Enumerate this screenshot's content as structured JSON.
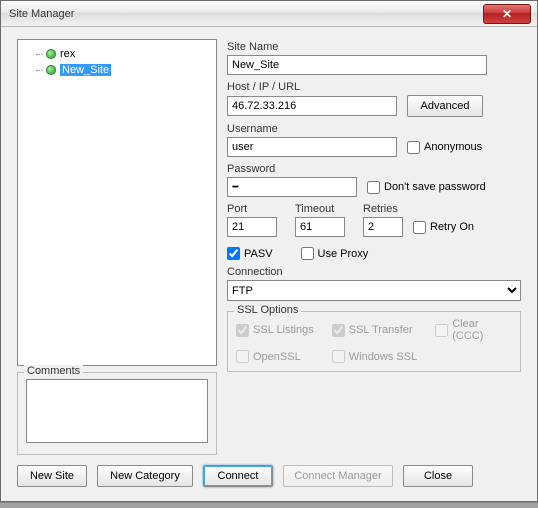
{
  "window": {
    "title": "Site Manager"
  },
  "tree": {
    "items": [
      {
        "label": "rex",
        "selected": false
      },
      {
        "label": "New_Site",
        "selected": true
      }
    ]
  },
  "comments": {
    "legend": "Comments",
    "value": ""
  },
  "form": {
    "siteName": {
      "label": "Site Name",
      "value": "New_Site"
    },
    "host": {
      "label": "Host / IP / URL",
      "value": "46.72.33.216"
    },
    "advanced": "Advanced",
    "username": {
      "label": "Username",
      "value": "user"
    },
    "anonymous": {
      "label": "Anonymous",
      "checked": false
    },
    "password": {
      "label": "Password",
      "value": "••••"
    },
    "dontSave": {
      "label": "Don't save password",
      "checked": false
    },
    "port": {
      "label": "Port",
      "value": "21"
    },
    "timeout": {
      "label": "Timeout",
      "value": "61"
    },
    "retries": {
      "label": "Retries",
      "value": "2"
    },
    "retryOn": {
      "label": "Retry On",
      "checked": false
    },
    "pasv": {
      "label": "PASV",
      "checked": true
    },
    "useProxy": {
      "label": "Use Proxy",
      "checked": false
    },
    "connection": {
      "label": "Connection",
      "value": "FTP"
    },
    "ssl": {
      "legend": "SSL Options",
      "listings": {
        "label": "SSL Listings",
        "checked": true
      },
      "transfer": {
        "label": "SSL Transfer",
        "checked": true
      },
      "clear": {
        "label": "Clear (CCC)",
        "checked": false
      },
      "openssl": {
        "label": "OpenSSL",
        "checked": false
      },
      "winssl": {
        "label": "Windows SSL",
        "checked": false
      }
    }
  },
  "buttons": {
    "newSite": "New Site",
    "newCategory": "New Category",
    "connect": "Connect",
    "connectManager": "Connect Manager",
    "close": "Close"
  }
}
